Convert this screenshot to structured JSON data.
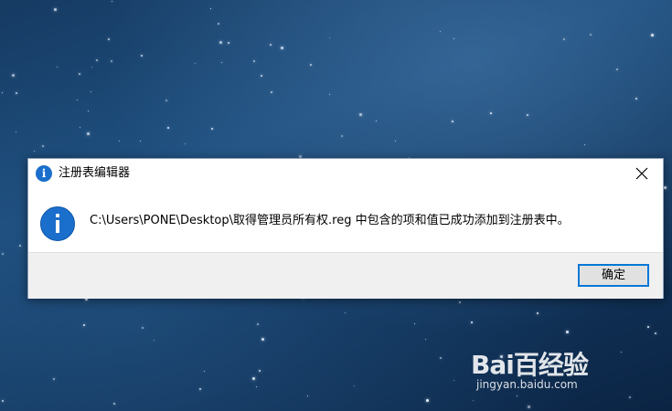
{
  "dialog": {
    "title": "注册表编辑器",
    "message": "C:\\Users\\PONE\\Desktop\\取得管理员所有权.reg 中包含的项和值已成功添加到注册表中。",
    "ok_label": "确定"
  },
  "watermark": {
    "logo": "Bai百经验",
    "url": "jingyan.baidu.com"
  },
  "colors": {
    "accent": "#0078d7",
    "info_icon": "#1a6fcc"
  }
}
